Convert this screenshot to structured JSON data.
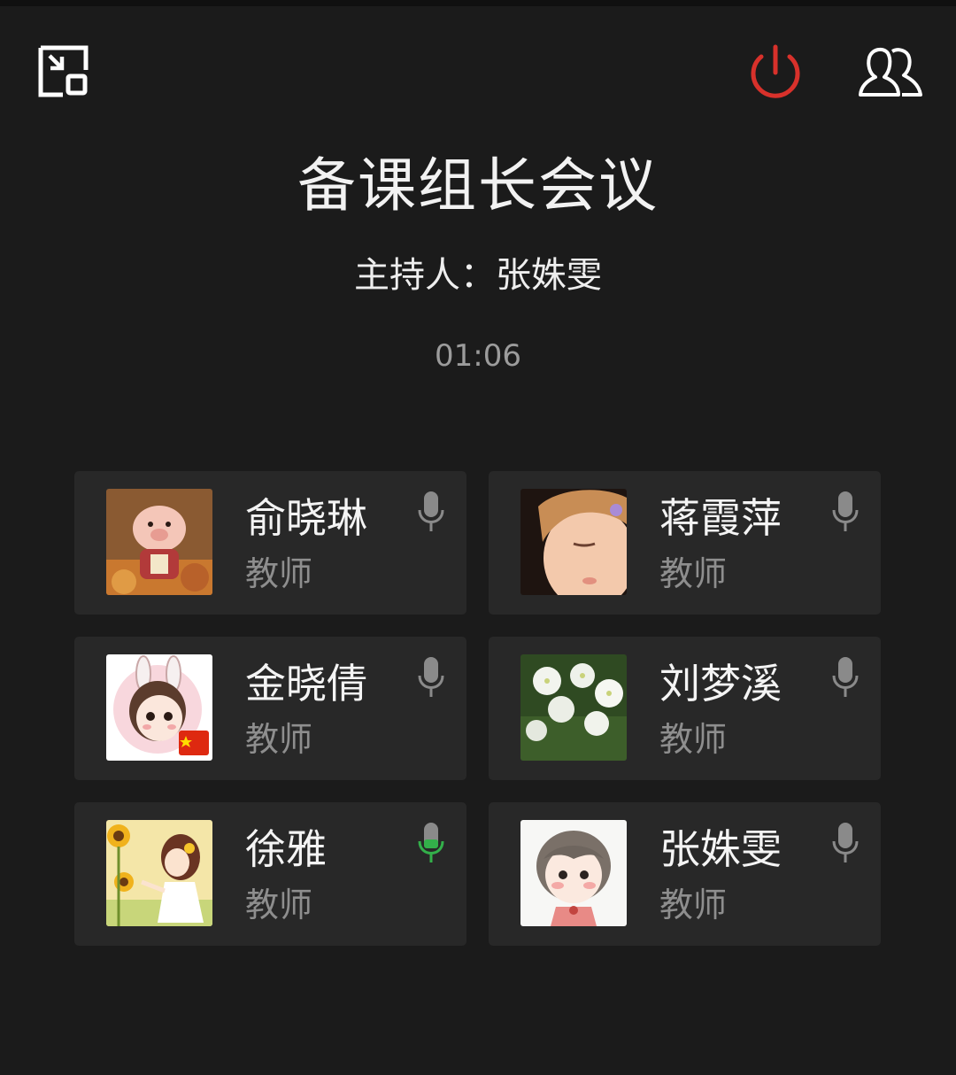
{
  "header": {
    "title": "备课组长会议",
    "host_line": "主持人：张姝雯",
    "timer": "01:06"
  },
  "icons": {
    "minimize": "minimize-window-icon",
    "hangup": "power-icon",
    "members": "members-icon"
  },
  "colors": {
    "background": "#1b1b1b",
    "card": "#282828",
    "hangup": "#d8312b",
    "mic_idle": "#8a8a8a",
    "mic_active": "#33b04a"
  },
  "participants": [
    {
      "name": "俞晓琳",
      "role": "教师",
      "avatar": "pig-cartoon",
      "mic": "idle"
    },
    {
      "name": "蒋霞萍",
      "role": "教师",
      "avatar": "child-photo",
      "mic": "idle"
    },
    {
      "name": "金晓倩",
      "role": "教师",
      "avatar": "bunny-girl-cartoon",
      "mic": "idle"
    },
    {
      "name": "刘梦溪",
      "role": "教师",
      "avatar": "white-flowers",
      "mic": "idle"
    },
    {
      "name": "徐雅",
      "role": "教师",
      "avatar": "sunflower-girl",
      "mic": "active"
    },
    {
      "name": "张姝雯",
      "role": "教师",
      "avatar": "short-hair-girl-cartoon",
      "mic": "idle"
    }
  ]
}
